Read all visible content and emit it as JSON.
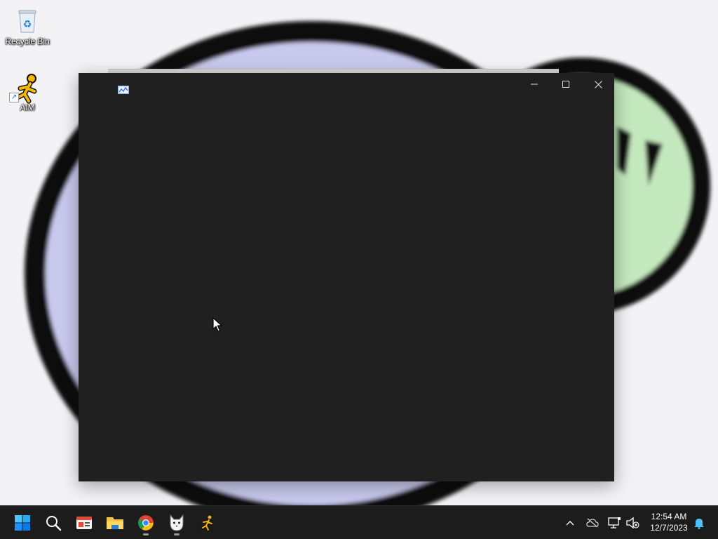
{
  "desktop": {
    "icons": [
      {
        "label": "Recycle Bin",
        "icon": "recycle-bin-icon"
      },
      {
        "label": "AIM",
        "icon": "aim-running-man-icon",
        "shortcut": true
      }
    ]
  },
  "window": {
    "title": "",
    "app_icon": "image-viewer-icon",
    "controls": {
      "minimize": "minimize-icon",
      "maximize": "maximize-icon",
      "close": "close-icon"
    },
    "background_color": "#202020"
  },
  "taskbar": {
    "background_color": "#1c1c1c",
    "apps": [
      {
        "name": "start",
        "icon": "windows-logo-icon"
      },
      {
        "name": "search",
        "icon": "search-icon"
      },
      {
        "name": "widgets",
        "icon": "widgets-icon"
      },
      {
        "name": "file-explorer",
        "icon": "folder-icon"
      },
      {
        "name": "chrome",
        "icon": "chrome-icon",
        "running": true
      },
      {
        "name": "cat-app",
        "icon": "cat-icon",
        "running": true
      },
      {
        "name": "aim",
        "icon": "aim-running-man-icon"
      }
    ],
    "tray": {
      "icons": [
        "chevron-up-icon",
        "onedrive-offline-icon",
        "network-icon",
        "volume-muted-icon",
        "notification-bell-icon"
      ],
      "time": "12:54 AM",
      "date": "12/7/2023"
    }
  },
  "accent_colors": {
    "windows_blue": "#1e90ff",
    "aim_yellow": "#f5b800",
    "folder_yellow": "#f6c343"
  }
}
